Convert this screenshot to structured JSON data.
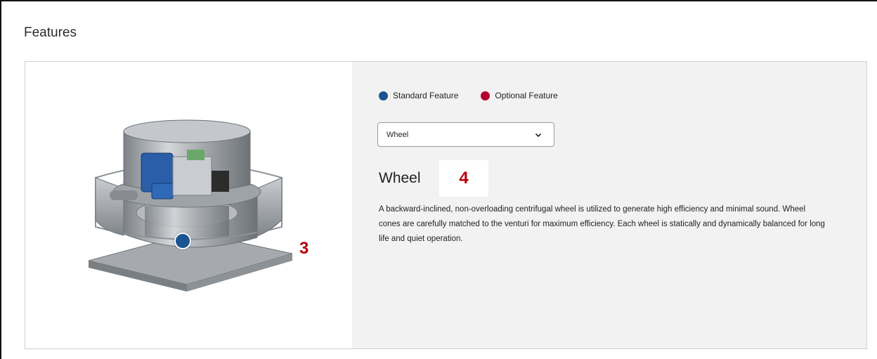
{
  "section": {
    "title": "Features"
  },
  "legend": {
    "standard_label": "Standard Feature",
    "optional_label": "Optional Feature",
    "standard_color": "#1a5590",
    "optional_color": "#b5002f"
  },
  "selector": {
    "value": "Wheel",
    "icon": "chevron-down-icon"
  },
  "feature": {
    "title": "Wheel",
    "description": "A backward-inclined, non-overloading centrifugal wheel is utilized to generate high efficiency and minimal sound. Wheel cones are carefully matched to the venturi for maximum efficiency. Each wheel is statically and dynamically balanced for long life and quiet operation."
  },
  "annotations": {
    "left_number": "3",
    "right_number": "4"
  },
  "image": {
    "subject": "rooftop-exhaust-fan"
  }
}
